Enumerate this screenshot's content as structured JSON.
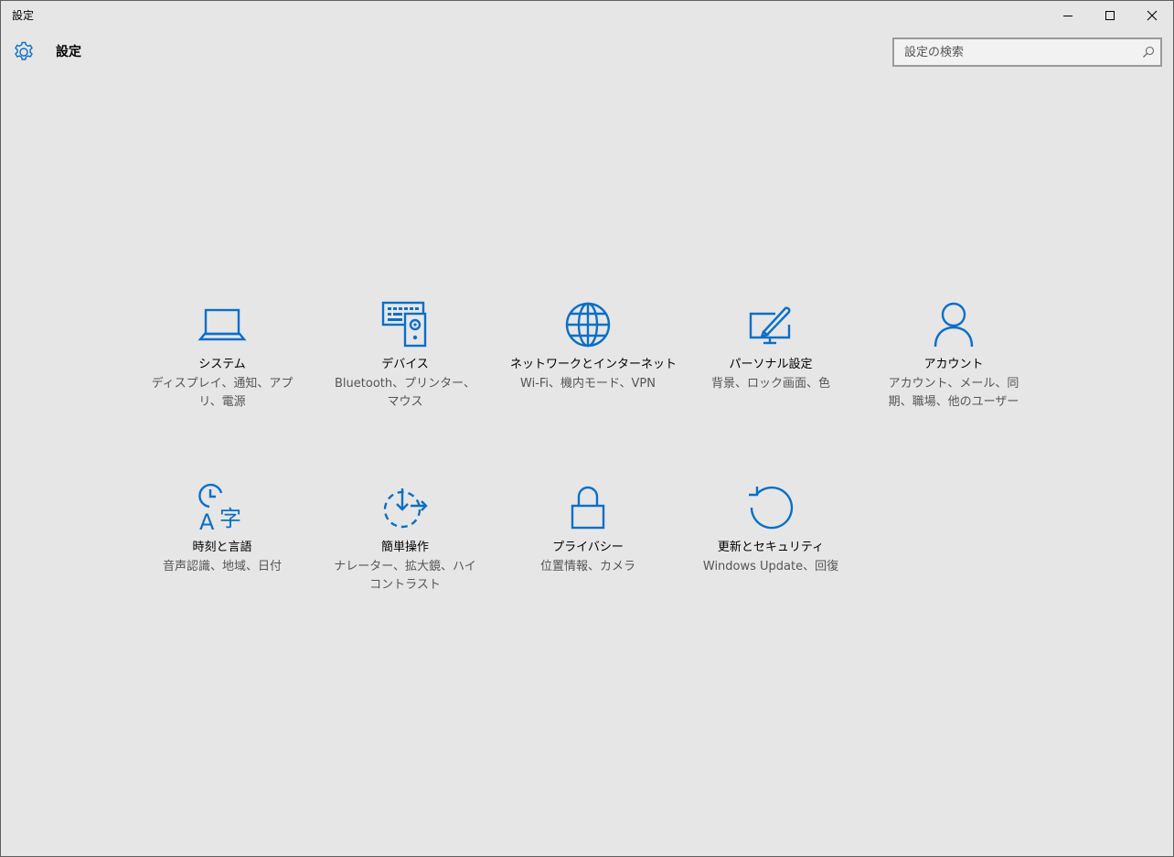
{
  "window": {
    "title": "設定"
  },
  "header": {
    "title": "設定",
    "search_placeholder": "設定の検索"
  },
  "colors": {
    "accent": "#0a6fc7",
    "background": "#e6e6e6",
    "secondary_text": "#555555"
  },
  "tiles": [
    {
      "icon": "laptop-icon",
      "name": "システム",
      "desc": "ディスプレイ、通知、アプリ、電源"
    },
    {
      "icon": "devices-icon",
      "name": "デバイス",
      "desc": "Bluetooth、プリンター、マウス"
    },
    {
      "icon": "globe-icon",
      "name": "ネットワークとインターネット",
      "desc": "Wi-Fi、機内モード、VPN"
    },
    {
      "icon": "personalization-icon",
      "name": "パーソナル設定",
      "desc": "背景、ロック画面、色"
    },
    {
      "icon": "person-icon",
      "name": "アカウント",
      "desc": "アカウント、メール、同期、職場、他のユーザー"
    },
    {
      "icon": "time-language-icon",
      "name": "時刻と言語",
      "desc": "音声認識、地域、日付"
    },
    {
      "icon": "ease-of-access-icon",
      "name": "簡単操作",
      "desc": "ナレーター、拡大鏡、ハイコントラスト"
    },
    {
      "icon": "lock-icon",
      "name": "プライバシー",
      "desc": "位置情報、カメラ"
    },
    {
      "icon": "update-icon",
      "name": "更新とセキュリティ",
      "desc": "Windows Update、回復"
    }
  ]
}
